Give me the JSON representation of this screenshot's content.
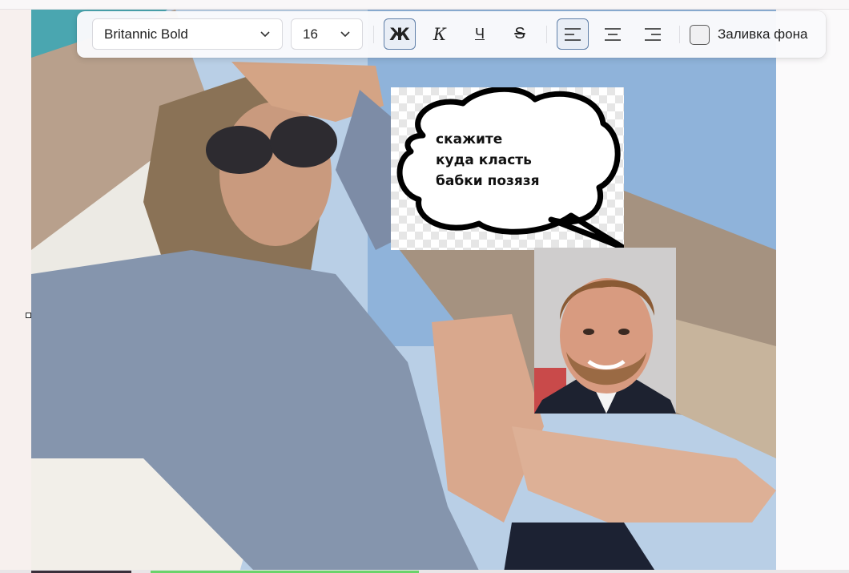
{
  "toolbar": {
    "font_family": "Britannic Bold",
    "font_size": "16",
    "bold_label": "Ж",
    "italic_label": "К",
    "underline_label": "Ч",
    "strike_label": "S",
    "bold_active": true,
    "align_active": "left",
    "fill_label": "Заливка фона",
    "fill_checked": false,
    "icons": {
      "font_dropdown": "chevron-down-icon",
      "size_dropdown": "chevron-down-icon",
      "align_left": "align-left-icon",
      "align_center": "align-center-icon",
      "align_right": "align-right-icon"
    }
  },
  "canvas": {
    "speech_bubble_text": "скажите\nкуда класть\nбабки позязя"
  },
  "colors": {
    "accent_border": "#5f7fa8",
    "active_bg": "#e9eef6",
    "bottom_green": "#6ad36a"
  }
}
